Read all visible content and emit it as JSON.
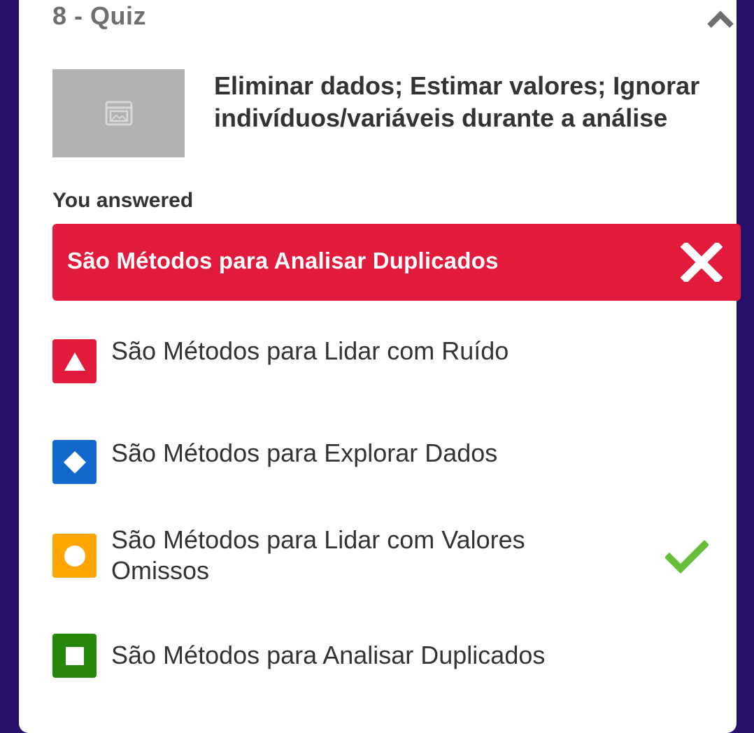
{
  "quiz": {
    "title": "8 - Quiz",
    "collapse_icon": "chevron-up-icon",
    "image_icon": "image-placeholder-icon",
    "question": "Eliminar dados; Estimar valores; Ignorar indivíduos/variáveis durante a análise"
  },
  "result": {
    "heading": "You answered",
    "answer": "São Métodos para Analisar Duplicados",
    "status_icon": "wrong-x-icon",
    "status_color": "#e21b3c"
  },
  "choices": [
    {
      "shape": "triangle",
      "color": "#e21b3c",
      "label": "São Métodos para Lidar com Ruído",
      "correct": false
    },
    {
      "shape": "diamond",
      "color": "#1368ce",
      "label": "São Métodos para Explorar Dados",
      "correct": false
    },
    {
      "shape": "circle",
      "color": "#ffa602",
      "label": "São Métodos para Lidar com Valores Omissos",
      "correct": true
    },
    {
      "shape": "square",
      "color": "#26890c",
      "label": "São Métodos para Analisar Duplicados",
      "correct": false
    }
  ],
  "colors": {
    "background": "#26106a",
    "card": "#ffffff",
    "correct_check": "#66bf39"
  }
}
